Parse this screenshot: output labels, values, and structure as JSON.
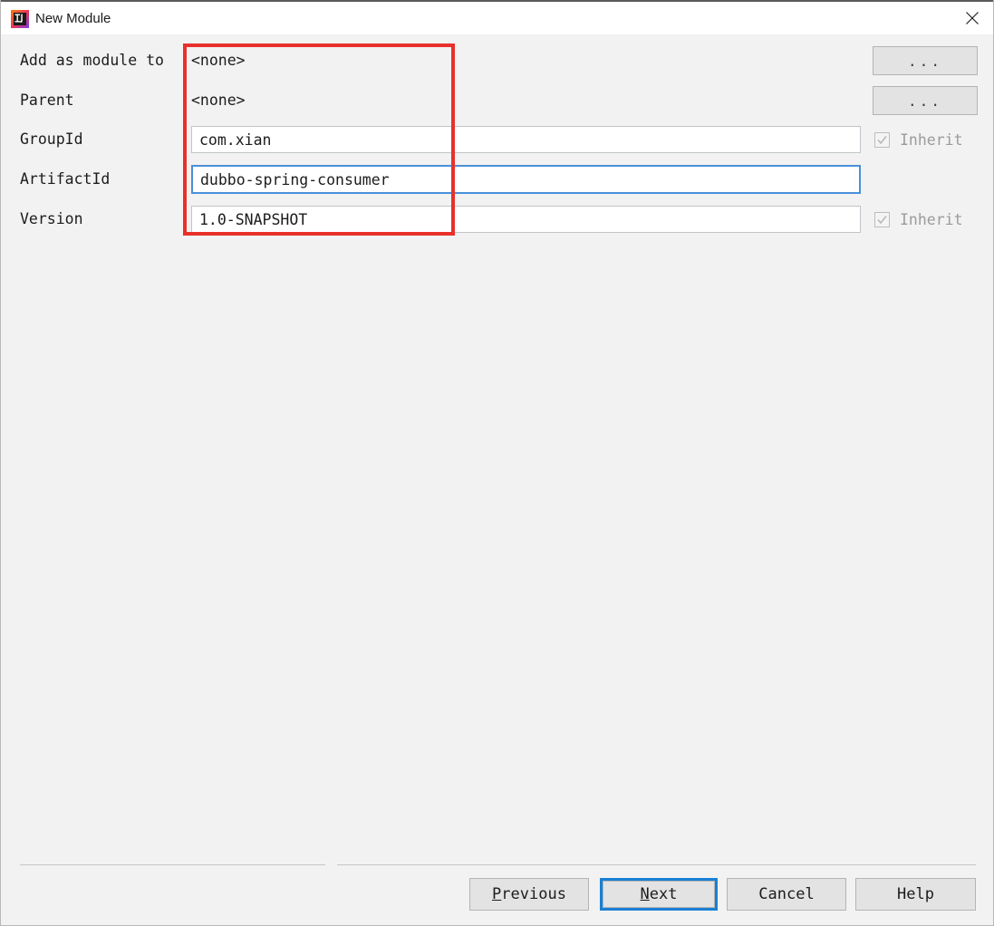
{
  "window": {
    "title": "New Module",
    "icon": "intellij-idea-logo-icon",
    "close_icon": "close-icon"
  },
  "form": {
    "rows": [
      {
        "label": "Add as module to",
        "kind": "static",
        "value": "<none>",
        "trailing": "dots-button",
        "trailing_label": "..."
      },
      {
        "label": "Parent",
        "kind": "static",
        "value": "<none>",
        "trailing": "dots-button",
        "trailing_label": "..."
      },
      {
        "label": "GroupId",
        "kind": "input",
        "value": "com.xian",
        "focused": false,
        "trailing": "checkbox",
        "trailing_label": "Inherit",
        "checked": true,
        "disabled": true
      },
      {
        "label": "ArtifactId",
        "kind": "input",
        "value": "dubbo-spring-consumer",
        "focused": true,
        "trailing": "none",
        "trailing_label": ""
      },
      {
        "label": "Version",
        "kind": "input",
        "value": "1.0-SNAPSHOT",
        "focused": false,
        "trailing": "checkbox",
        "trailing_label": "Inherit",
        "checked": true,
        "disabled": true
      }
    ]
  },
  "annotation": {
    "type": "red-rectangle-highlight",
    "color": "#e8312a"
  },
  "footer": {
    "buttons": [
      {
        "name": "previous",
        "label": "Previous",
        "mnemonic": "P",
        "default": false
      },
      {
        "name": "next",
        "label": "Next",
        "mnemonic": "N",
        "default": true
      },
      {
        "name": "cancel",
        "label": "Cancel",
        "mnemonic": "",
        "default": false
      },
      {
        "name": "help",
        "label": "Help",
        "mnemonic": "",
        "default": false
      }
    ]
  },
  "colors": {
    "accent_focus": "#1a7fd4",
    "input_focus_border": "#4a90d9",
    "annotation_red": "#e8312a",
    "window_background": "#f2f2f2",
    "titlebar_background": "#ffffff"
  }
}
